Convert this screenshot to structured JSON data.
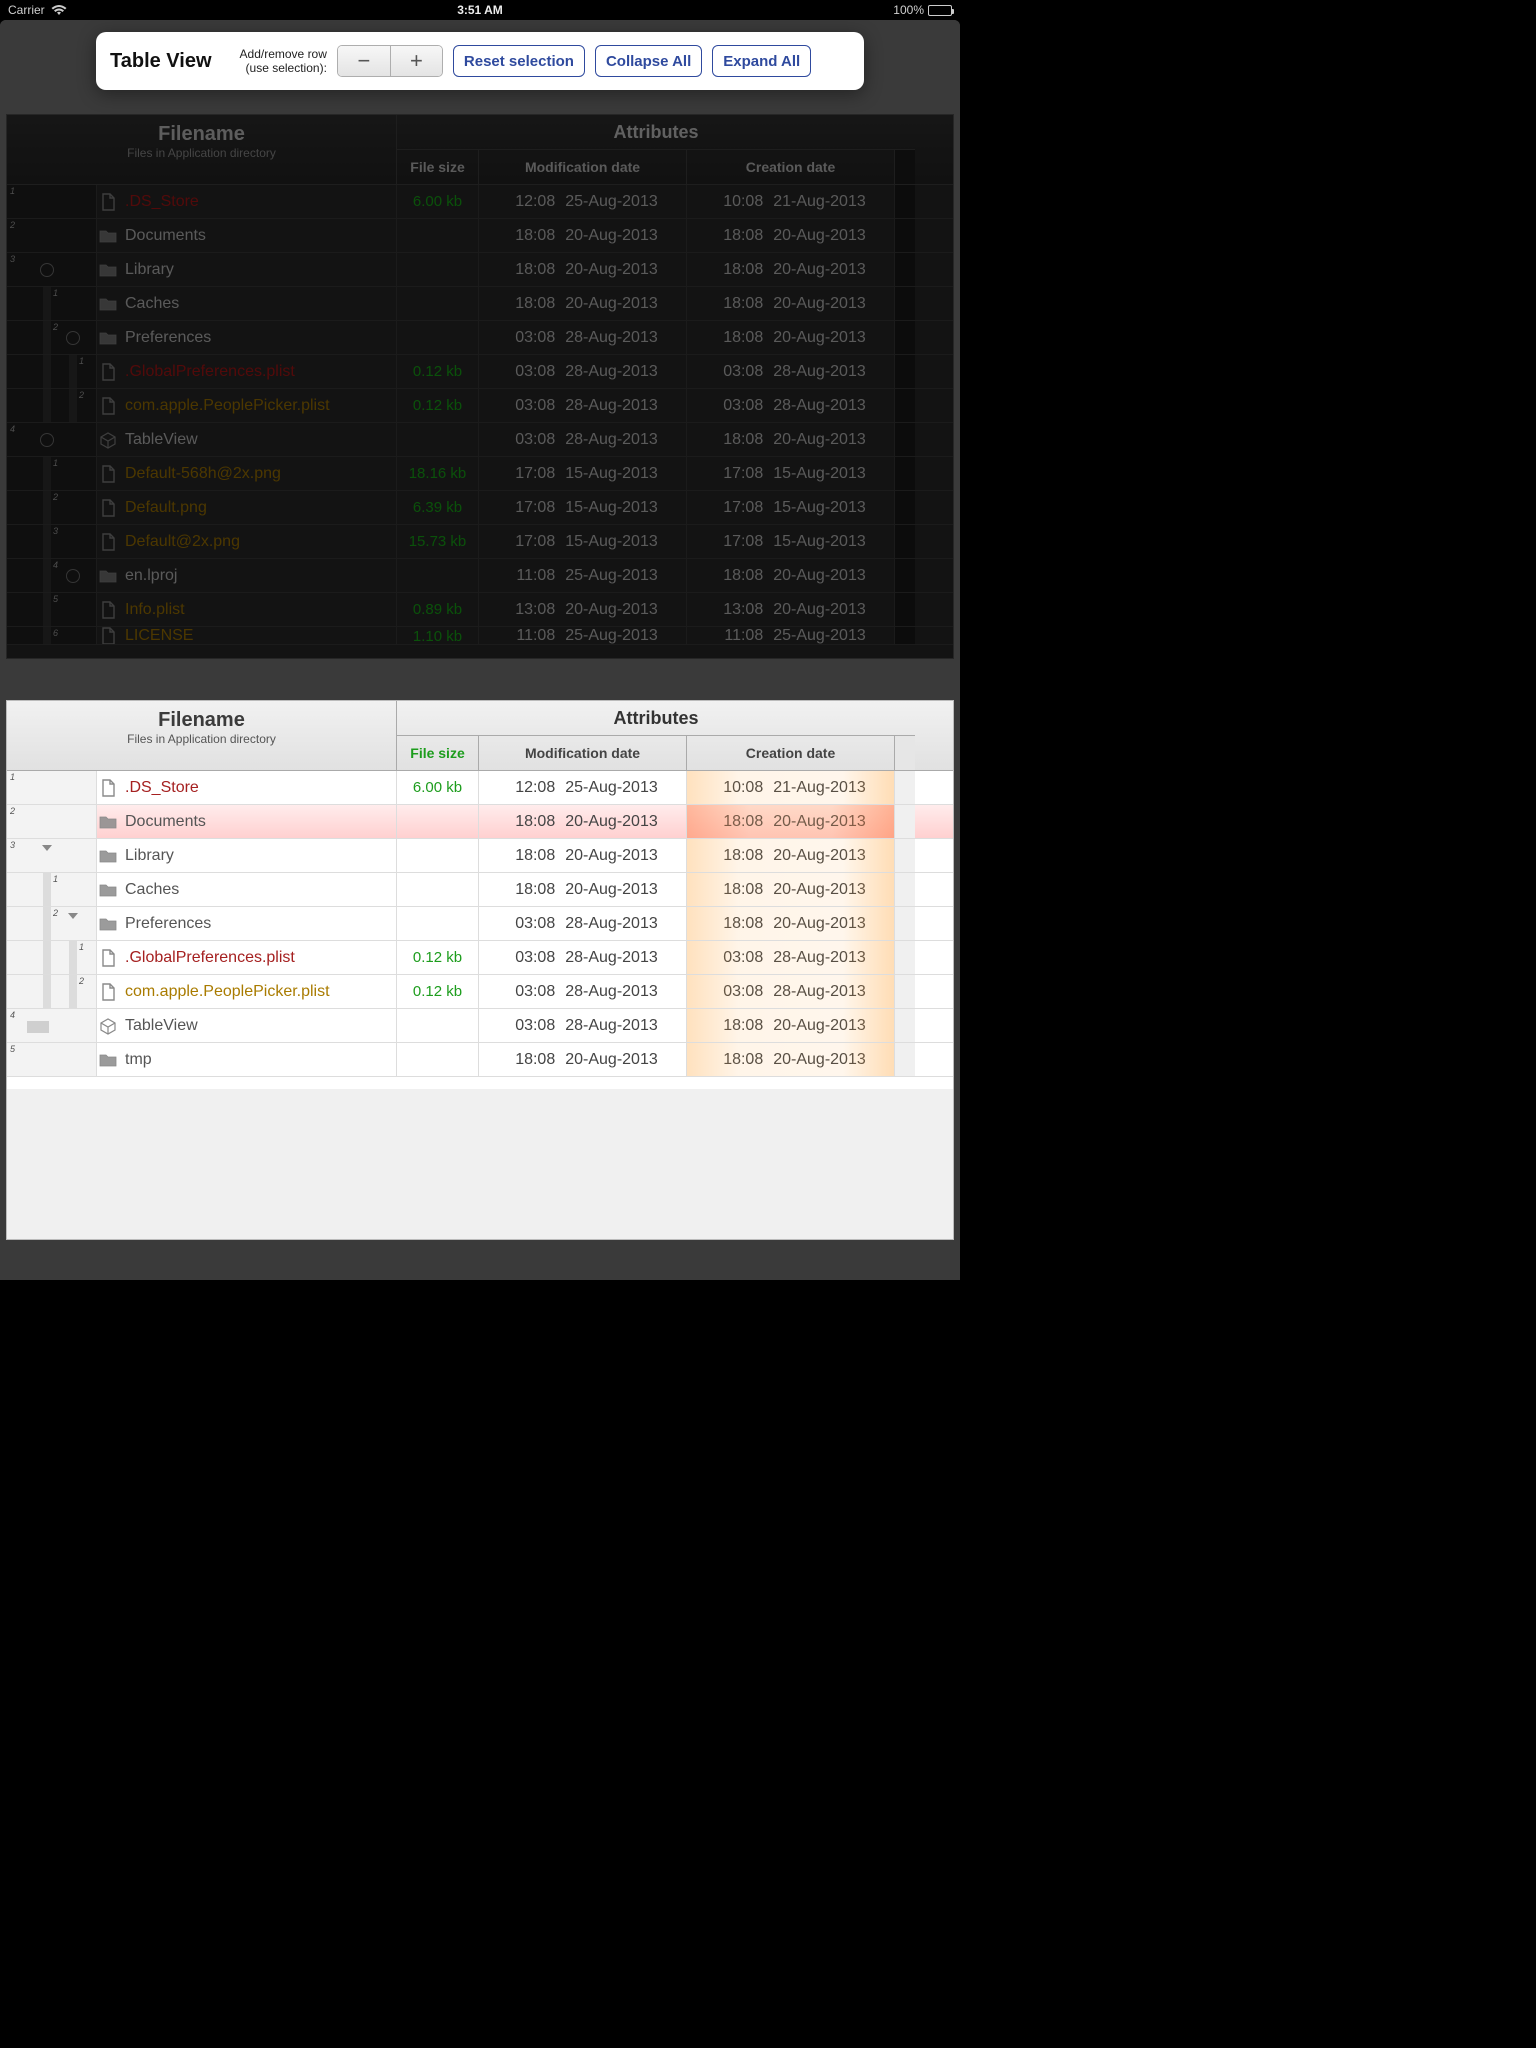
{
  "status": {
    "carrier": "Carrier",
    "time": "3:51 AM",
    "battery_pct": "100%"
  },
  "toolbar": {
    "title": "Table View",
    "hint_line1": "Add/remove row",
    "hint_line2": "(use selection):",
    "minus": "−",
    "plus": "+",
    "reset": "Reset selection",
    "collapse": "Collapse All",
    "expand": "Expand All"
  },
  "headers": {
    "filename": "Filename",
    "filename_sub": "Files in Application directory",
    "attributes": "Attributes",
    "file_size": "File size",
    "mod_date": "Modification date",
    "create_date": "Creation date"
  },
  "dark_rows": [
    {
      "n": "1",
      "icon": "file",
      "name": ".DS_Store",
      "cls": "c-dred",
      "size": "6.00 kb",
      "mt": "12:08",
      "md": "25-Aug-2013",
      "ct": "10:08",
      "cd": "21-Aug-2013",
      "depth": 0
    },
    {
      "n": "2",
      "icon": "folder",
      "name": "Documents",
      "cls": "c-gray",
      "size": "",
      "mt": "18:08",
      "md": "20-Aug-2013",
      "ct": "18:08",
      "cd": "20-Aug-2013",
      "depth": 0
    },
    {
      "n": "3",
      "icon": "folder",
      "name": "Library",
      "cls": "c-gray",
      "size": "",
      "mt": "18:08",
      "md": "20-Aug-2013",
      "ct": "18:08",
      "cd": "20-Aug-2013",
      "depth": 0,
      "rad": true,
      "radx": 36
    },
    {
      "n": "1",
      "icon": "folder",
      "name": "Caches",
      "cls": "c-gray",
      "size": "",
      "mt": "18:08",
      "md": "20-Aug-2013",
      "ct": "18:08",
      "cd": "20-Aug-2013",
      "depth": 1,
      "bars": [
        36
      ]
    },
    {
      "n": "2",
      "icon": "folder",
      "name": "Preferences",
      "cls": "c-gray",
      "size": "",
      "mt": "03:08",
      "md": "28-Aug-2013",
      "ct": "18:08",
      "cd": "20-Aug-2013",
      "depth": 1,
      "bars": [
        36
      ],
      "rad": true,
      "radx": 62
    },
    {
      "n": "1",
      "icon": "file",
      "name": ".GlobalPreferences.plist",
      "cls": "c-dred",
      "size": "0.12 kb",
      "mt": "03:08",
      "md": "28-Aug-2013",
      "ct": "03:08",
      "cd": "28-Aug-2013",
      "depth": 2,
      "bars": [
        36,
        62
      ]
    },
    {
      "n": "2",
      "icon": "file",
      "name": "com.apple.PeoplePicker.plist",
      "cls": "c-olive",
      "size": "0.12 kb",
      "mt": "03:08",
      "md": "28-Aug-2013",
      "ct": "03:08",
      "cd": "28-Aug-2013",
      "depth": 2,
      "bars": [
        36,
        62
      ]
    },
    {
      "n": "4",
      "icon": "app",
      "name": "TableView",
      "cls": "c-gray",
      "size": "",
      "mt": "03:08",
      "md": "28-Aug-2013",
      "ct": "18:08",
      "cd": "20-Aug-2013",
      "depth": 0,
      "rad": true,
      "radx": 36
    },
    {
      "n": "1",
      "icon": "file",
      "name": "Default-568h@2x.png",
      "cls": "c-olive",
      "size": "18.16 kb",
      "mt": "17:08",
      "md": "15-Aug-2013",
      "ct": "17:08",
      "cd": "15-Aug-2013",
      "depth": 1,
      "bars": [
        36
      ]
    },
    {
      "n": "2",
      "icon": "file",
      "name": "Default.png",
      "cls": "c-olive",
      "size": "6.39 kb",
      "mt": "17:08",
      "md": "15-Aug-2013",
      "ct": "17:08",
      "cd": "15-Aug-2013",
      "depth": 1,
      "bars": [
        36
      ]
    },
    {
      "n": "3",
      "icon": "file",
      "name": "Default@2x.png",
      "cls": "c-olive",
      "size": "15.73 kb",
      "mt": "17:08",
      "md": "15-Aug-2013",
      "ct": "17:08",
      "cd": "15-Aug-2013",
      "depth": 1,
      "bars": [
        36
      ]
    },
    {
      "n": "4",
      "icon": "folder",
      "name": "en.lproj",
      "cls": "c-gray",
      "size": "",
      "mt": "11:08",
      "md": "25-Aug-2013",
      "ct": "18:08",
      "cd": "20-Aug-2013",
      "depth": 1,
      "bars": [
        36
      ],
      "rad": true,
      "radx": 62
    },
    {
      "n": "5",
      "icon": "file",
      "name": "Info.plist",
      "cls": "c-olive",
      "size": "0.89 kb",
      "mt": "13:08",
      "md": "20-Aug-2013",
      "ct": "13:08",
      "cd": "20-Aug-2013",
      "depth": 1,
      "bars": [
        36
      ]
    },
    {
      "n": "6",
      "icon": "file",
      "name": "LICENSE",
      "cls": "c-olive",
      "size": "1.10 kb",
      "mt": "11:08",
      "md": "25-Aug-2013",
      "ct": "11:08",
      "cd": "25-Aug-2013",
      "depth": 1,
      "bars": [
        36
      ],
      "cut": true
    }
  ],
  "light_rows": [
    {
      "n": "1",
      "icon": "file",
      "name": ".DS_Store",
      "cls": "c-red",
      "size": "6.00 kb",
      "mt": "12:08",
      "md": "25-Aug-2013",
      "ct": "10:08",
      "cd": "21-Aug-2013",
      "depth": 0
    },
    {
      "n": "2",
      "icon": "folder",
      "name": "Documents",
      "cls": "c-gray",
      "size": "",
      "mt": "18:08",
      "md": "20-Aug-2013",
      "ct": "18:08",
      "cd": "20-Aug-2013",
      "depth": 0,
      "sel": true
    },
    {
      "n": "3",
      "icon": "folder",
      "name": "Library",
      "cls": "c-gray",
      "size": "",
      "mt": "18:08",
      "md": "20-Aug-2013",
      "ct": "18:08",
      "cd": "20-Aug-2013",
      "depth": 0,
      "chev": true,
      "chevx": 36
    },
    {
      "n": "1",
      "icon": "folder",
      "name": "Caches",
      "cls": "c-gray",
      "size": "",
      "mt": "18:08",
      "md": "20-Aug-2013",
      "ct": "18:08",
      "cd": "20-Aug-2013",
      "depth": 1,
      "bars": [
        36
      ]
    },
    {
      "n": "2",
      "icon": "folder",
      "name": "Preferences",
      "cls": "c-gray",
      "size": "",
      "mt": "03:08",
      "md": "28-Aug-2013",
      "ct": "18:08",
      "cd": "20-Aug-2013",
      "depth": 1,
      "bars": [
        36
      ],
      "chev": true,
      "chevx": 62
    },
    {
      "n": "1",
      "icon": "file",
      "name": ".GlobalPreferences.plist",
      "cls": "c-red",
      "size": "0.12 kb",
      "mt": "03:08",
      "md": "28-Aug-2013",
      "ct": "03:08",
      "cd": "28-Aug-2013",
      "depth": 2,
      "bars": [
        36,
        62
      ]
    },
    {
      "n": "2",
      "icon": "file",
      "name": "com.apple.PeoplePicker.plist",
      "cls": "c-olive",
      "size": "0.12 kb",
      "mt": "03:08",
      "md": "28-Aug-2013",
      "ct": "03:08",
      "cd": "28-Aug-2013",
      "depth": 2,
      "bars": [
        36,
        62
      ]
    },
    {
      "n": "4",
      "icon": "app",
      "name": "TableView",
      "cls": "c-gray",
      "size": "",
      "mt": "03:08",
      "md": "28-Aug-2013",
      "ct": "18:08",
      "cd": "20-Aug-2013",
      "depth": 0,
      "arrow": true
    },
    {
      "n": "5",
      "icon": "folder",
      "name": "tmp",
      "cls": "c-gray",
      "size": "",
      "mt": "18:08",
      "md": "20-Aug-2013",
      "ct": "18:08",
      "cd": "20-Aug-2013",
      "depth": 0
    }
  ]
}
